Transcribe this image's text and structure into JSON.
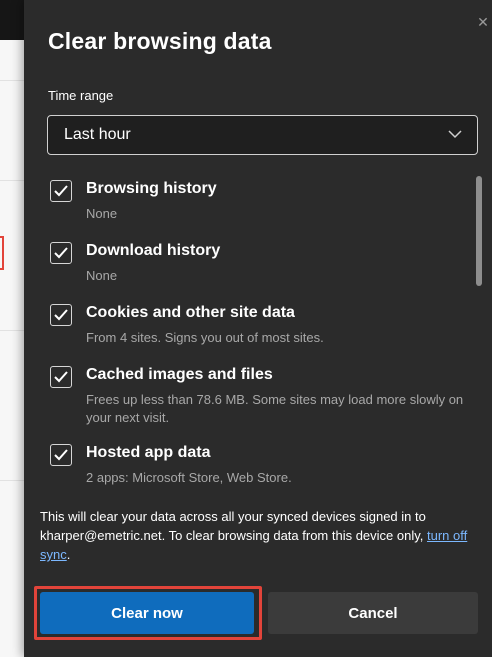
{
  "dialog": {
    "title": "Clear browsing data",
    "close_icon": "close-icon"
  },
  "time_range": {
    "label": "Time range",
    "selected": "Last hour"
  },
  "items": [
    {
      "title": "Browsing history",
      "desc": "None",
      "checked": true
    },
    {
      "title": "Download history",
      "desc": "None",
      "checked": true
    },
    {
      "title": "Cookies and other site data",
      "desc": "From 4 sites. Signs you out of most sites.",
      "checked": true
    },
    {
      "title": "Cached images and files",
      "desc": "Frees up less than 78.6 MB. Some sites may load more slowly on your next visit.",
      "checked": true
    },
    {
      "title": "Hosted app data",
      "desc": "2 apps: Microsoft Store, Web Store.",
      "checked": true
    }
  ],
  "sync_note": {
    "text": "This will clear your data across all your synced devices signed in to kharper@emetric.net. To clear browsing data from this device only,",
    "link": "turn off sync",
    "end": "."
  },
  "buttons": {
    "clear": "Clear now",
    "cancel": "Cancel"
  },
  "colors": {
    "primary": "#0f6cbd",
    "highlight": "#e2443a",
    "link": "#7cb8ff",
    "dialog_bg": "#2b2b2b"
  }
}
